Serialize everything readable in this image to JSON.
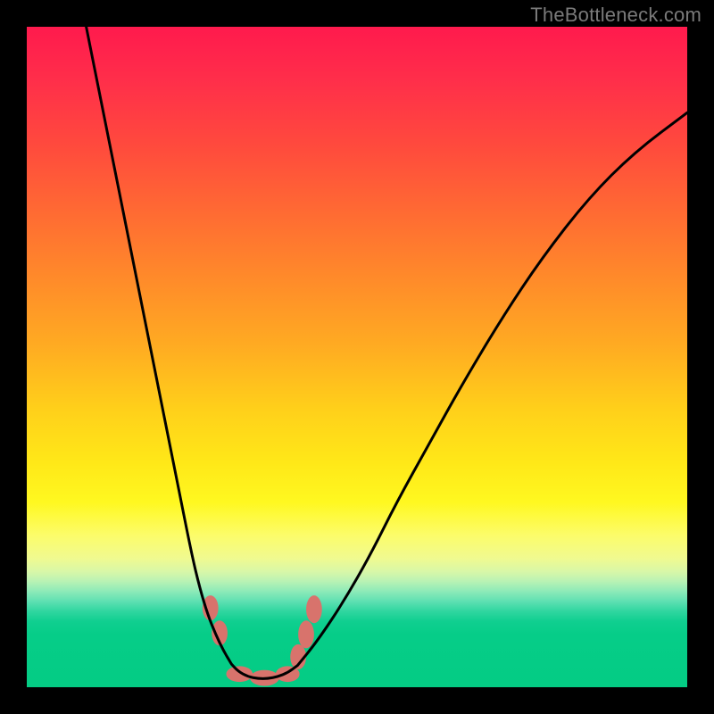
{
  "watermark": {
    "text": "TheBottleneck.com"
  },
  "chart_data": {
    "type": "line",
    "title": "",
    "xlabel": "",
    "ylabel": "",
    "xlim": [
      0,
      1
    ],
    "ylim": [
      0,
      1
    ],
    "grid": false,
    "legend": false,
    "series": [
      {
        "name": "left-branch",
        "x": [
          0.09,
          0.11,
          0.13,
          0.15,
          0.17,
          0.19,
          0.21,
          0.23,
          0.25,
          0.262,
          0.274,
          0.286,
          0.298,
          0.31
        ],
        "values": [
          1.0,
          0.9,
          0.8,
          0.7,
          0.6,
          0.5,
          0.4,
          0.3,
          0.2,
          0.15,
          0.11,
          0.08,
          0.055,
          0.035
        ]
      },
      {
        "name": "valley-floor",
        "x": [
          0.31,
          0.32,
          0.335,
          0.35,
          0.365,
          0.38,
          0.395,
          0.41
        ],
        "values": [
          0.035,
          0.024,
          0.016,
          0.013,
          0.013,
          0.016,
          0.022,
          0.033
        ]
      },
      {
        "name": "right-branch",
        "x": [
          0.41,
          0.44,
          0.48,
          0.52,
          0.56,
          0.61,
          0.66,
          0.72,
          0.78,
          0.85,
          0.92,
          1.0
        ],
        "values": [
          0.033,
          0.07,
          0.13,
          0.2,
          0.28,
          0.37,
          0.46,
          0.56,
          0.65,
          0.74,
          0.81,
          0.87
        ]
      }
    ],
    "markers": [
      {
        "name": "left-blob-upper",
        "cx": 0.278,
        "cy": 0.12,
        "rx": 0.012,
        "ry": 0.019
      },
      {
        "name": "left-blob-lower",
        "cx": 0.292,
        "cy": 0.082,
        "rx": 0.012,
        "ry": 0.019
      },
      {
        "name": "right-blob-upper",
        "cx": 0.435,
        "cy": 0.118,
        "rx": 0.012,
        "ry": 0.021
      },
      {
        "name": "right-blob-mid",
        "cx": 0.423,
        "cy": 0.08,
        "rx": 0.012,
        "ry": 0.021
      },
      {
        "name": "right-blob-lower",
        "cx": 0.411,
        "cy": 0.046,
        "rx": 0.012,
        "ry": 0.019
      },
      {
        "name": "floor-blob-1",
        "cx": 0.322,
        "cy": 0.02,
        "rx": 0.02,
        "ry": 0.012
      },
      {
        "name": "floor-blob-2",
        "cx": 0.36,
        "cy": 0.014,
        "rx": 0.022,
        "ry": 0.012
      },
      {
        "name": "floor-blob-3",
        "cx": 0.395,
        "cy": 0.02,
        "rx": 0.018,
        "ry": 0.012
      }
    ],
    "colors": {
      "curve": "#000000",
      "marker": "#d8736c",
      "background_top": "#ff1a4d",
      "background_mid": "#ffe818",
      "background_bottom": "#04cc84"
    }
  }
}
